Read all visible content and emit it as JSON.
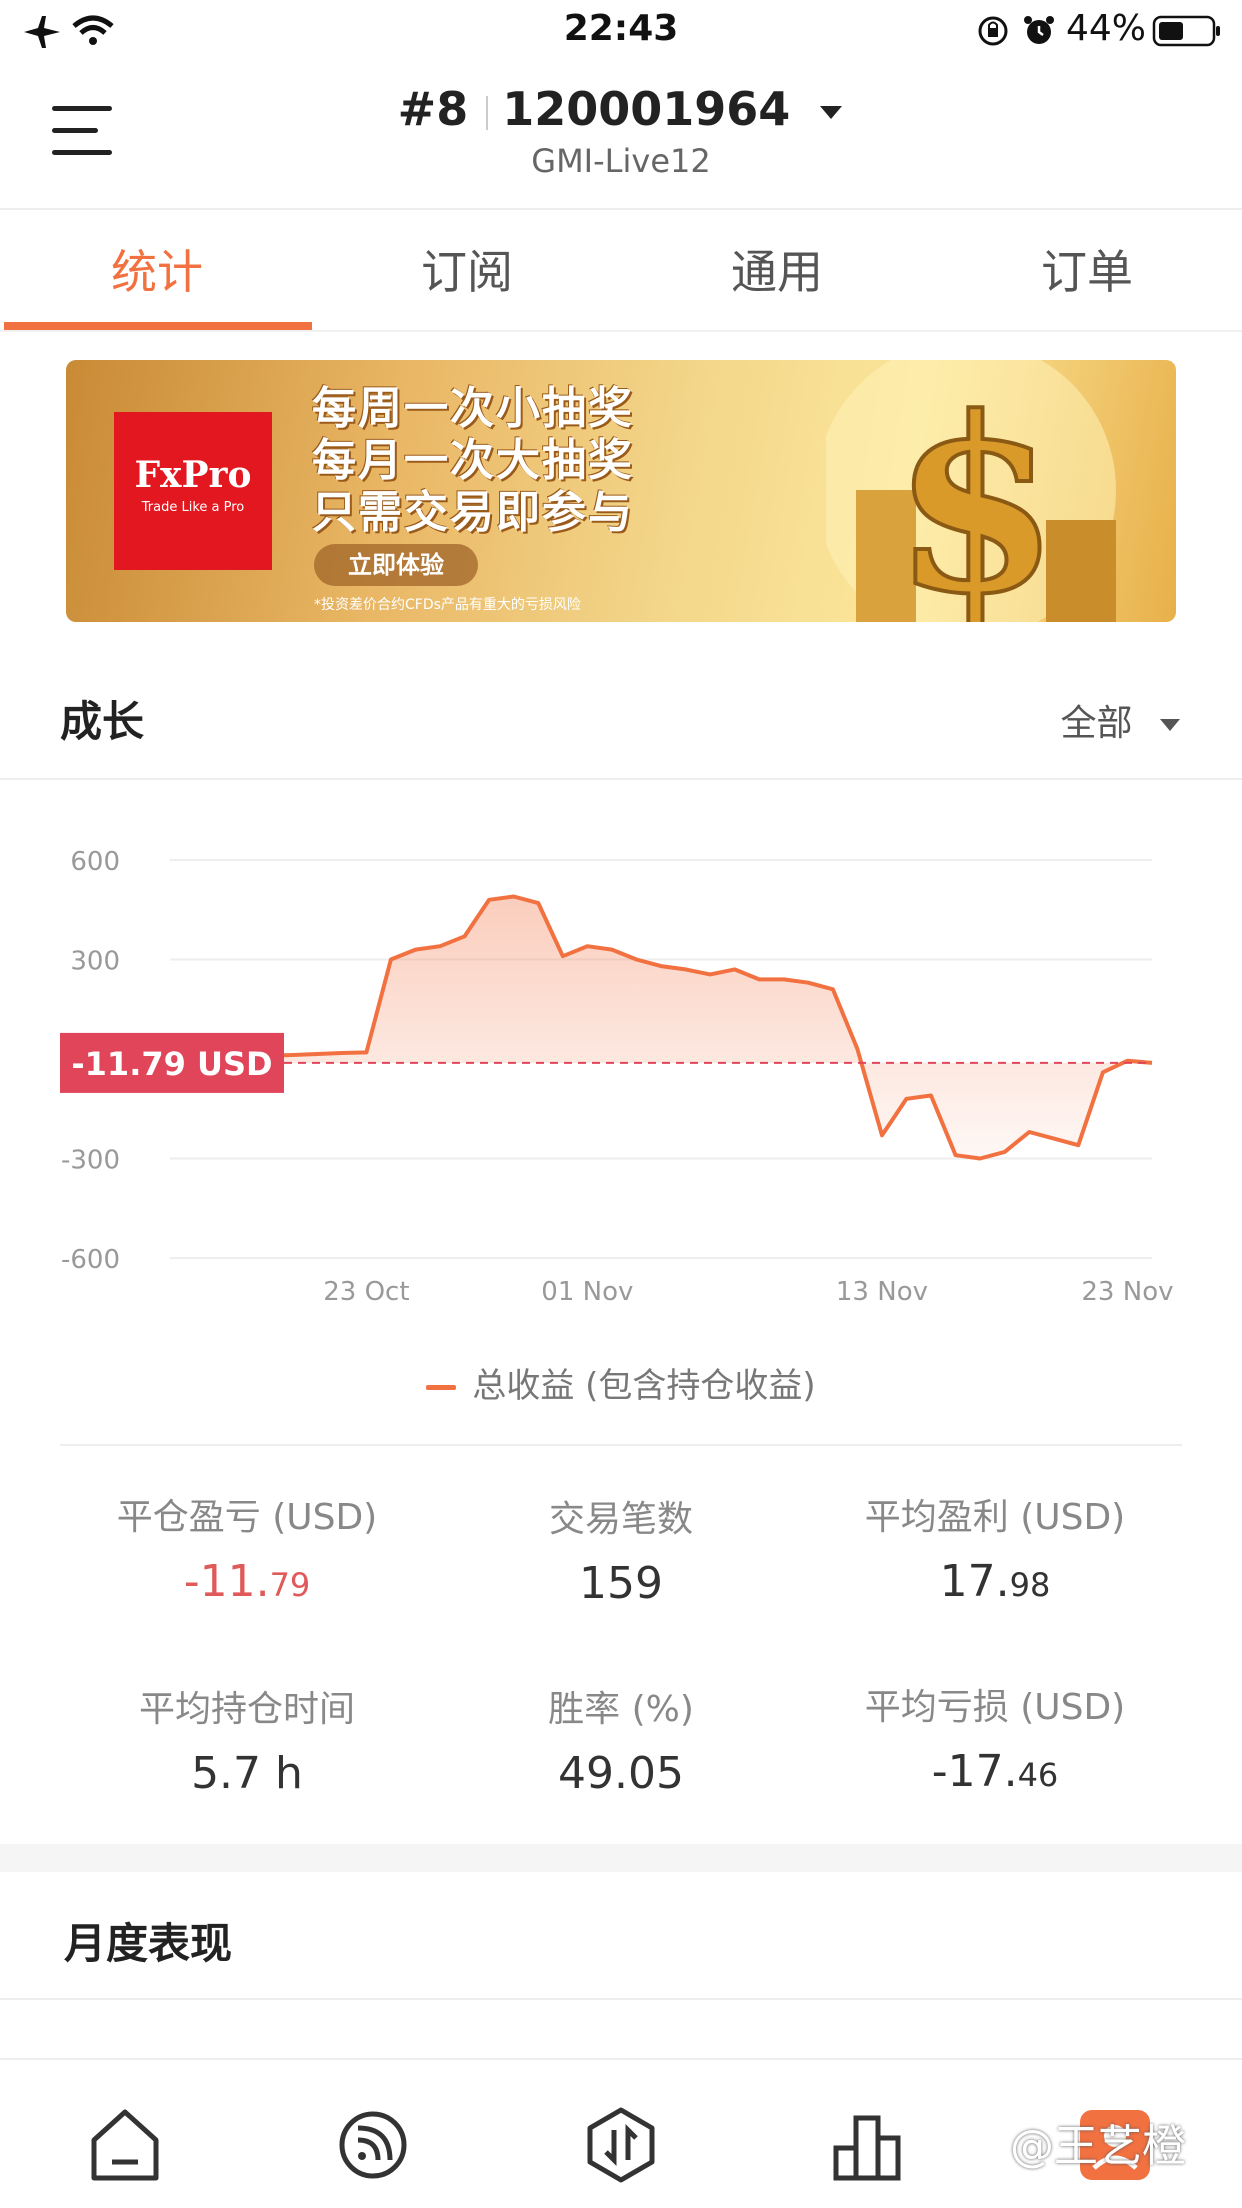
{
  "status_bar": {
    "time": "22:43",
    "battery_text": "44%"
  },
  "header": {
    "account_prefix": "#8",
    "account_number": "120001964",
    "server": "GMI-Live12"
  },
  "tabs": [
    {
      "label": "统计",
      "active": true
    },
    {
      "label": "订阅",
      "active": false
    },
    {
      "label": "通用",
      "active": false
    },
    {
      "label": "订单",
      "active": false
    }
  ],
  "banner": {
    "brand": "FxPro",
    "tagline": "Trade Like a Pro",
    "lines": [
      "每周一次小抽奖",
      "每月一次大抽奖",
      "只需交易即参与"
    ],
    "cta": "立即体验",
    "disclaimer": "*投资差价合约CFDs产品有重大的亏损风险"
  },
  "growth": {
    "title": "成长",
    "filter": "全部"
  },
  "chart_data": {
    "type": "area",
    "x": [
      "15 Oct",
      "16 Oct",
      "17 Oct",
      "18 Oct",
      "19 Oct",
      "20 Oct",
      "21 Oct",
      "22 Oct",
      "23 Oct",
      "24 Oct",
      "25 Oct",
      "26 Oct",
      "27 Oct",
      "28 Oct",
      "29 Oct",
      "30 Oct",
      "31 Oct",
      "01 Nov",
      "02 Nov",
      "03 Nov",
      "04 Nov",
      "05 Nov",
      "06 Nov",
      "07 Nov",
      "08 Nov",
      "09 Nov",
      "10 Nov",
      "11 Nov",
      "12 Nov",
      "13 Nov",
      "14 Nov",
      "15 Nov",
      "16 Nov",
      "17 Nov",
      "18 Nov",
      "19 Nov",
      "20 Nov",
      "21 Nov",
      "22 Nov",
      "23 Nov",
      "24 Nov"
    ],
    "series": [
      {
        "name": "总收益 (包含持仓收益)",
        "values": [
          20,
          10,
          5,
          8,
          10,
          12,
          15,
          18,
          20,
          300,
          330,
          340,
          370,
          480,
          490,
          470,
          310,
          340,
          330,
          300,
          280,
          270,
          255,
          270,
          240,
          240,
          230,
          210,
          30,
          -230,
          -120,
          -110,
          -290,
          -300,
          -280,
          -220,
          -240,
          -260,
          -40,
          -5,
          -11.79
        ]
      }
    ],
    "x_ticks": [
      "23 Oct",
      "01 Nov",
      "13 Nov",
      "23 Nov"
    ],
    "y_ticks": [
      600,
      300,
      -300,
      -600
    ],
    "ylim": [
      -600,
      600
    ],
    "reference_value": -11.79,
    "reference_label": "-11.79 USD",
    "grid": true,
    "legend_placement": "bottom-center",
    "color": "#f27141"
  },
  "stats": {
    "closed_pl": {
      "label": "平仓盈亏 (USD)",
      "int": "-11.",
      "dec": "79"
    },
    "trades": {
      "label": "交易笔数",
      "value": "159"
    },
    "avg_profit": {
      "label": "平均盈利 (USD)",
      "int": "17.",
      "dec": "98"
    },
    "avg_hold": {
      "label": "平均持仓时间",
      "value": "5.7 h"
    },
    "win_rate": {
      "label": "胜率 (%)",
      "value": "49.05"
    },
    "avg_loss": {
      "label": "平均亏损 (USD)",
      "int": "-17.",
      "dec": "46"
    }
  },
  "monthly": {
    "title": "月度表现"
  },
  "watermark": "@王艺橙",
  "colors": {
    "accent": "#f27141",
    "negative": "#e05a5a"
  }
}
